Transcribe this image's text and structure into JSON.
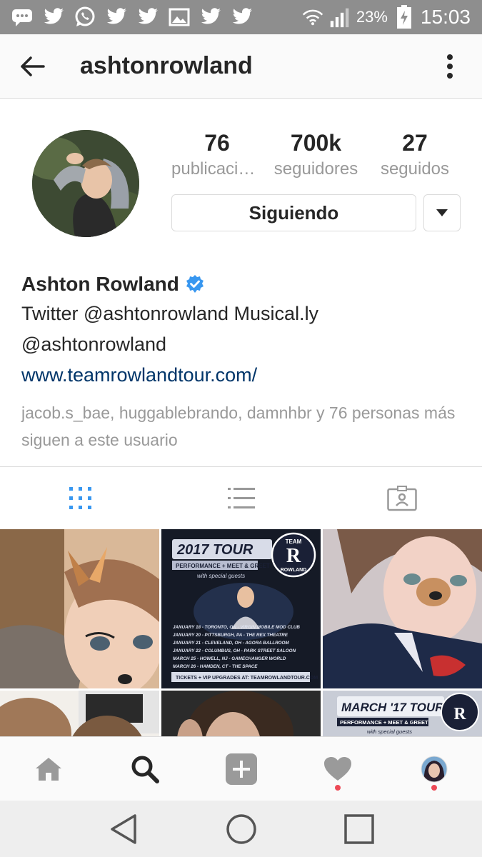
{
  "status_bar": {
    "icons": [
      "chat-icon",
      "twitter-icon",
      "whatsapp-icon",
      "twitter-icon",
      "twitter-icon",
      "image-icon",
      "twitter-icon",
      "twitter-icon"
    ],
    "battery_percent": "23%",
    "time": "15:03"
  },
  "header": {
    "username": "ashtonrowland"
  },
  "profile": {
    "stats": [
      {
        "value": "76",
        "label": "publicaciones"
      },
      {
        "value": "700k",
        "label": "seguidores"
      },
      {
        "value": "27",
        "label": "seguidos"
      }
    ],
    "follow_button_label": "Siguiendo",
    "name": "Ashton Rowland",
    "bio_line1": "Twitter @ashtonrowland Musical.ly",
    "bio_line2": "@ashtonrowland",
    "website": "www.teamrowlandtour.com/",
    "followed_by": "jacob.s_bae, huggablebrando, damnhbr y 76 personas más siguen a este usuario"
  },
  "grid": {
    "tour_post_1": {
      "title": "2017 TOUR",
      "subtitle": "PERFORMANCE + MEET & GREET",
      "guests": "with special guests",
      "badge_top": "TEAM",
      "badge_letter": "R",
      "badge_bottom": "ROWLAND",
      "dates": [
        "JANUARY 18 - TORONTO, ON - VIRGIN MOBILE MOD CLUB",
        "JANUARY 20 - PITTSBURGH, PA - THE REX THEATRE",
        "JANUARY 21 - CLEVELAND, OH - AGORA BALLROOM",
        "JANUARY 22 - COLUMBUS, OH - PARK STREET SALOON",
        "MARCH 25 - HOWELL, NJ - GAMECHANGER WORLD",
        "MARCH 26 - HAMDEN, CT - THE SPACE"
      ],
      "footer": "TICKETS + VIP UPGRADES AT: TEAMROWLANDTOUR.COM"
    },
    "tour_post_2": {
      "title": "MARCH '17 TOUR",
      "subtitle": "PERFORMANCE + MEET & GREET",
      "guests": "with special guests"
    }
  },
  "colors": {
    "accent_blue": "#3897f0",
    "link_blue": "#003569",
    "notification_red": "#ed4956",
    "status_bar": "#8e8e8e"
  }
}
